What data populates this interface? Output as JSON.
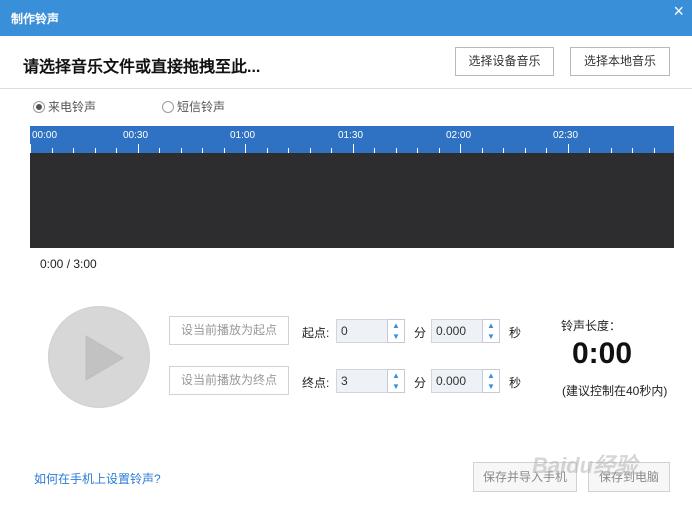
{
  "window": {
    "title": "制作铃声",
    "close_icon": "×"
  },
  "header": {
    "prompt": "请选择音乐文件或直接拖拽至此...",
    "device_music_button": "选择设备音乐",
    "local_music_button": "选择本地音乐"
  },
  "ringtone_type": {
    "options": [
      {
        "label": "来电铃声",
        "checked": true
      },
      {
        "label": "短信铃声",
        "checked": false
      }
    ]
  },
  "timeline": {
    "labels": [
      "00:00",
      "00:30",
      "01:00",
      "01:30",
      "02:00",
      "02:30"
    ],
    "bar_color": "#2f72c3",
    "wave_color": "#2d2d2f"
  },
  "playback": {
    "time_readout": "0:00 / 3:00"
  },
  "range": {
    "set_start_button": "设当前播放为起点",
    "set_end_button": "设当前播放为终点",
    "start_label": "起点:",
    "end_label": "终点:",
    "start_minutes": "0",
    "start_seconds": "0.000",
    "end_minutes": "3",
    "end_seconds": "0.000",
    "minute_unit": "分",
    "second_unit": "秒"
  },
  "length": {
    "label": "铃声长度：",
    "value": "0:00",
    "hint": "(建议控制在40秒内)"
  },
  "footer": {
    "help_link": "如何在手机上设置铃声?",
    "save_import_button": "保存并导入手机",
    "save_pc_button": "保存到电脑",
    "watermark": "Baidu经验"
  },
  "colors": {
    "accent": "#3a8fd9",
    "link": "#2b7bd6"
  }
}
